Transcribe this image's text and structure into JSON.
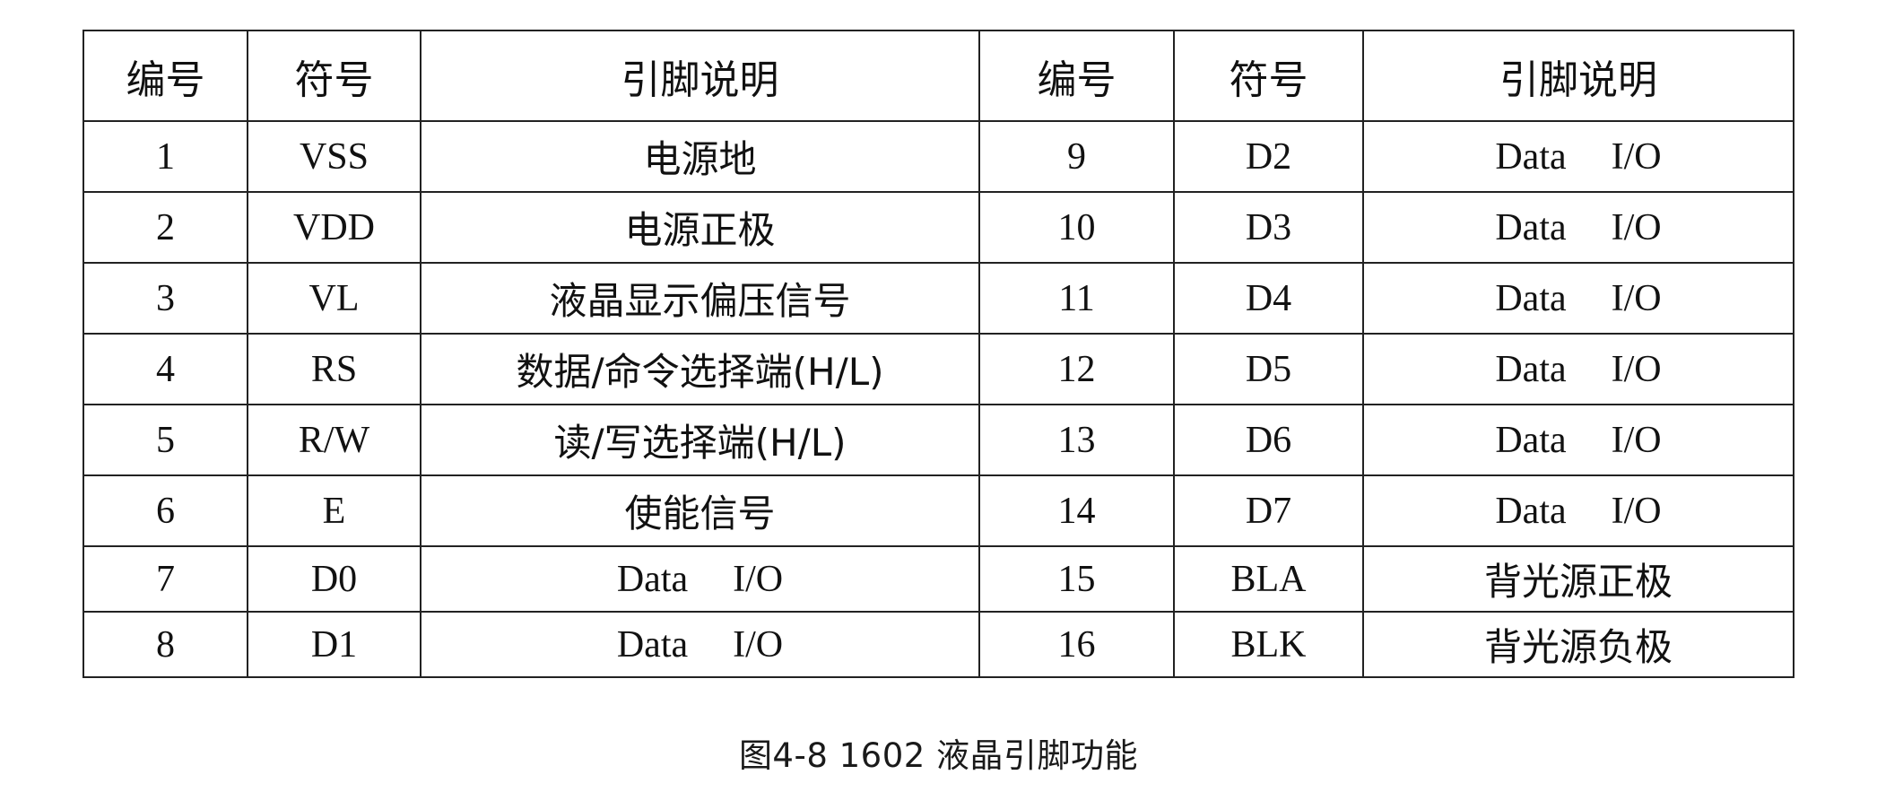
{
  "table": {
    "headers": [
      "编号",
      "符号",
      "引脚说明",
      "编号",
      "符号",
      "引脚说明"
    ],
    "rows": [
      {
        "left": {
          "num": "1",
          "sym": "VSS",
          "desc": "电源地"
        },
        "right": {
          "num": "9",
          "sym": "D2",
          "desc": [
            "Data",
            "I/O"
          ]
        }
      },
      {
        "left": {
          "num": "2",
          "sym": "VDD",
          "desc": "电源正极"
        },
        "right": {
          "num": "10",
          "sym": "D3",
          "desc": [
            "Data",
            "I/O"
          ]
        }
      },
      {
        "left": {
          "num": "3",
          "sym": "VL",
          "desc": "液晶显示偏压信号"
        },
        "right": {
          "num": "11",
          "sym": "D4",
          "desc": [
            "Data",
            "I/O"
          ]
        }
      },
      {
        "left": {
          "num": "4",
          "sym": "RS",
          "desc": "数据/命令选择端(H/L)"
        },
        "right": {
          "num": "12",
          "sym": "D5",
          "desc": [
            "Data",
            "I/O"
          ]
        }
      },
      {
        "left": {
          "num": "5",
          "sym": "R/W",
          "desc": "读/写选择端(H/L)"
        },
        "right": {
          "num": "13",
          "sym": "D6",
          "desc": [
            "Data",
            "I/O"
          ]
        }
      },
      {
        "left": {
          "num": "6",
          "sym": "E",
          "desc": "使能信号"
        },
        "right": {
          "num": "14",
          "sym": "D7",
          "desc": [
            "Data",
            "I/O"
          ]
        }
      },
      {
        "left": {
          "num": "7",
          "sym": "D0",
          "desc": [
            "Data",
            "I/O"
          ]
        },
        "right": {
          "num": "15",
          "sym": "BLA",
          "desc": "背光源正极"
        }
      },
      {
        "left": {
          "num": "8",
          "sym": "D1",
          "desc": [
            "Data",
            "I/O"
          ]
        },
        "right": {
          "num": "16",
          "sym": "BLK",
          "desc": "背光源负极"
        }
      }
    ]
  },
  "caption": "图4-8 1602 液晶引脚功能"
}
